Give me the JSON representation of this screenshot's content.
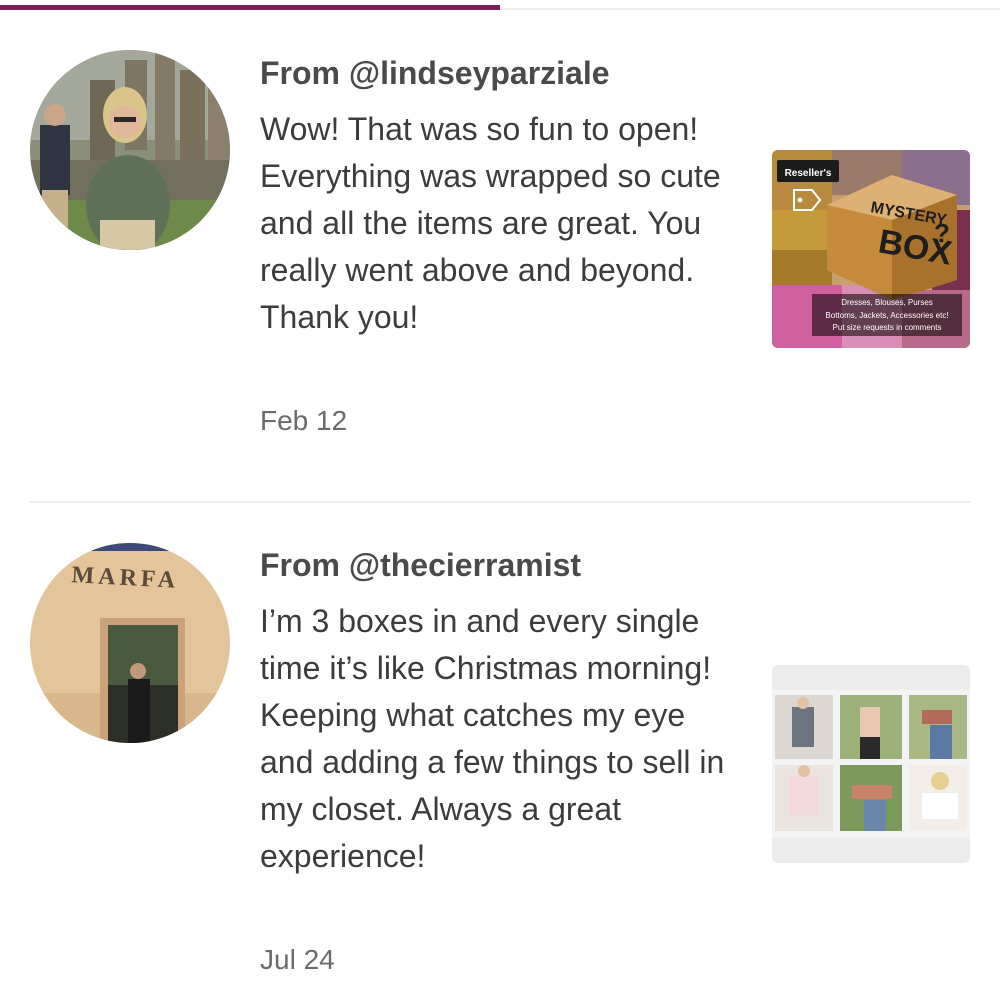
{
  "reviews": [
    {
      "from": "From @lindseyparziale",
      "text": "Wow! That was so fun to open! Everything was wrapped so cute and all the items are great. You really went above and beyond. Thank you!",
      "date": "Feb 12",
      "listing": {
        "badge": "Reseller's",
        "title_line1": "MYSTERY",
        "title_line2": "BOX",
        "question_mark": "?",
        "caption_line1": "Dresses, Blouses, Purses",
        "caption_line2": "Bottoms, Jackets, Accessories etc!",
        "caption_line3": "Put size requests in comments"
      }
    },
    {
      "from": "From @thecierramist",
      "text": "I’m 3 boxes in and every single time it’s like Christmas morning! Keeping what catches my eye and adding a few things to sell in my closet. Always a great experience!",
      "date": "Jul 24",
      "avatar_sign": "MARFA"
    }
  ],
  "colors": {
    "tab_indicator": "#7b1f5a",
    "divider": "#ececec",
    "mystery_box": "#c58a3c"
  },
  "icons": [
    "tag-icon"
  ]
}
